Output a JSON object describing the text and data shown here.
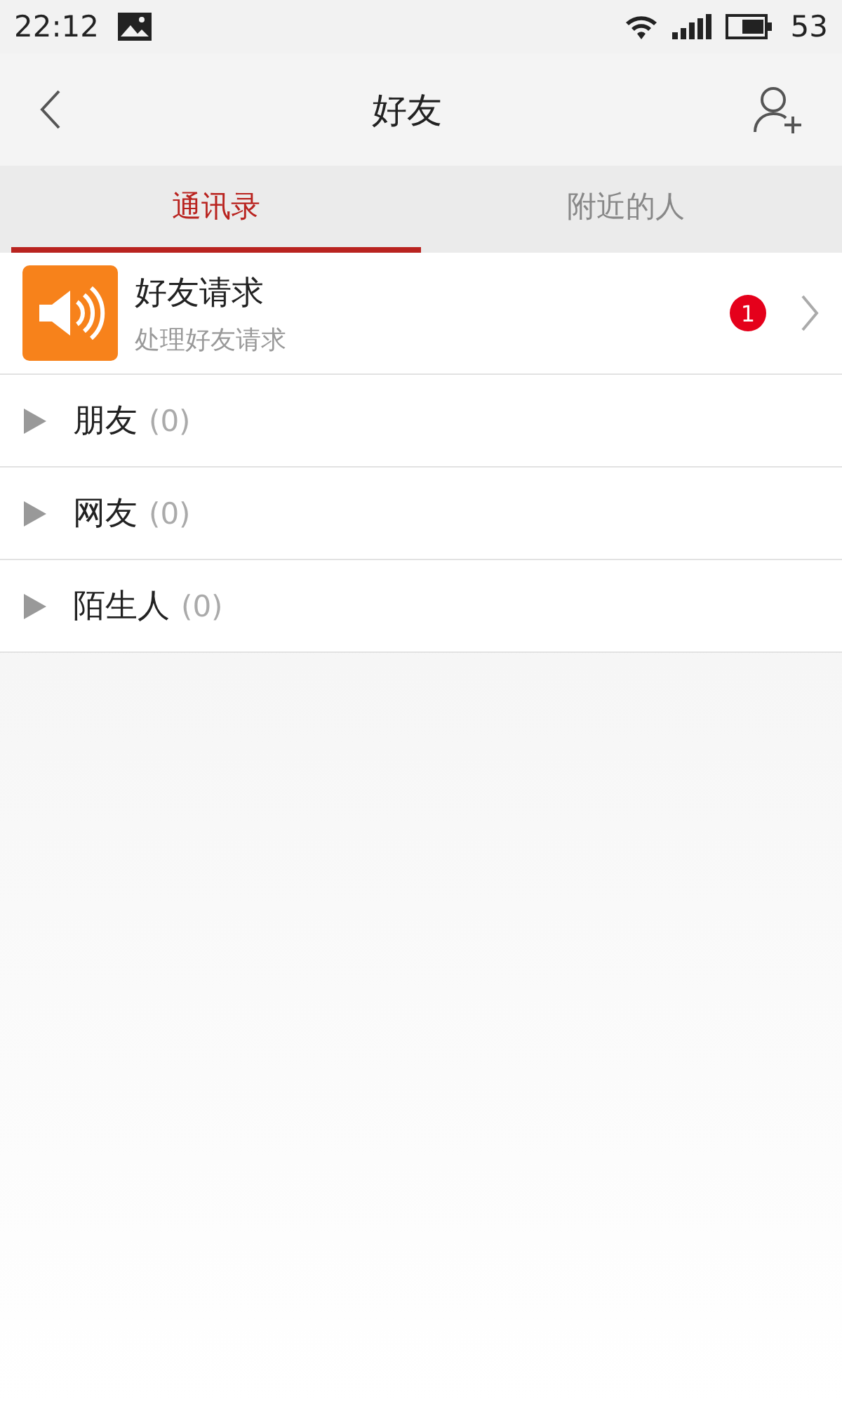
{
  "status_bar": {
    "time": "22:12",
    "battery": "53"
  },
  "header": {
    "title": "好友"
  },
  "tabs": [
    {
      "label": "通讯录",
      "selected": true
    },
    {
      "label": "附近的人",
      "selected": false
    }
  ],
  "request": {
    "title": "好友请求",
    "subtitle": "处理好友请求",
    "badge": "1"
  },
  "groups": [
    {
      "name": "朋友",
      "count": "(0)",
      "expanded": false
    },
    {
      "name": "网友",
      "count": "(0)",
      "expanded": false
    },
    {
      "name": "陌生人",
      "count": "(0)",
      "expanded": false
    }
  ]
}
